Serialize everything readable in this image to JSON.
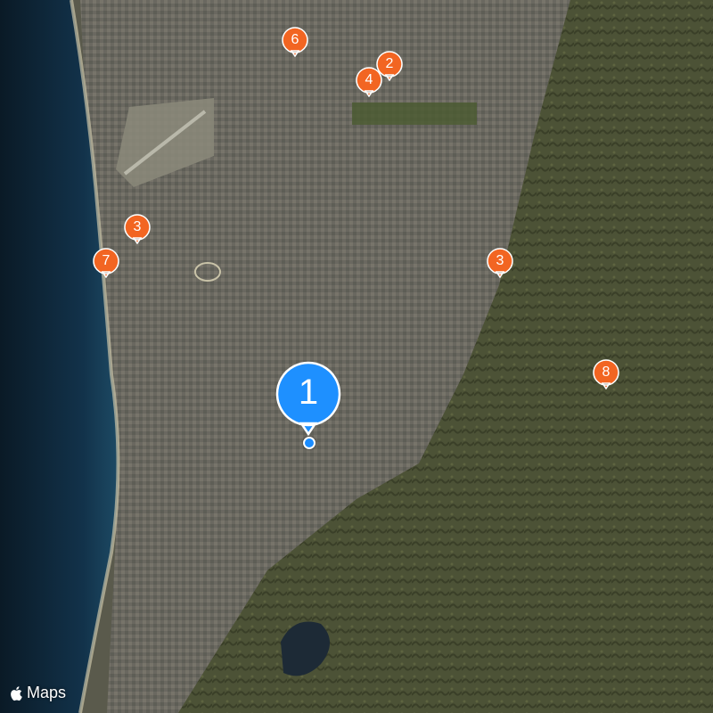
{
  "map": {
    "type": "satellite",
    "attribution": "Maps",
    "markers": [
      {
        "label": "1",
        "kind": "selected",
        "color": "#1e90ff"
      },
      {
        "label": "2",
        "kind": "place",
        "color": "#f26522"
      },
      {
        "label": "3",
        "kind": "place",
        "color": "#f26522"
      },
      {
        "label": "4",
        "kind": "place",
        "color": "#f26522"
      },
      {
        "label": "6",
        "kind": "place",
        "color": "#f26522"
      },
      {
        "label": "7",
        "kind": "place",
        "color": "#f26522"
      },
      {
        "label": "8",
        "kind": "place",
        "color": "#f26522"
      },
      {
        "label": "9",
        "kind": "place",
        "color": "#f26522"
      }
    ],
    "current_location_color": "#1a8cff",
    "icons": {
      "attribution_logo": "apple-logo-icon"
    }
  }
}
